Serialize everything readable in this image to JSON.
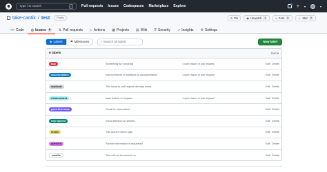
{
  "topbar": {
    "search_text": "Type / to search",
    "search_key": "/",
    "nav": [
      "Pull requests",
      "Issues",
      "Codespaces",
      "Marketplace",
      "Explore"
    ],
    "plus": "+",
    "caret": "▾"
  },
  "repo": {
    "owner": "take-cantik",
    "separator": "/",
    "name": "test",
    "visibility": "Public",
    "actions": [
      {
        "label": "Pin",
        "icon": "pin-icon",
        "count": ""
      },
      {
        "label": "Unwatch",
        "icon": "eye-icon",
        "count": "1"
      },
      {
        "label": "Fork",
        "icon": "fork-icon",
        "count": "0"
      },
      {
        "label": "Star",
        "icon": "star-icon",
        "count": "0"
      }
    ],
    "tabs": [
      {
        "label": "Code",
        "icon": "<>",
        "count": ""
      },
      {
        "label": "Issues",
        "icon": "◎",
        "count": "8"
      },
      {
        "label": "Pull requests",
        "icon": "⇅",
        "count": ""
      },
      {
        "label": "Actions",
        "icon": "▷",
        "count": ""
      },
      {
        "label": "Projects",
        "icon": "▦",
        "count": ""
      },
      {
        "label": "Wiki",
        "icon": "▤",
        "count": ""
      },
      {
        "label": "Security",
        "icon": "⛨",
        "count": ""
      },
      {
        "label": "Insights",
        "icon": "↗",
        "count": ""
      },
      {
        "label": "Settings",
        "icon": "⚙",
        "count": ""
      }
    ]
  },
  "toolbar": {
    "labels_tab": "Labels",
    "milestones_tab": "Milestones",
    "search_placeholder": "Search all labels",
    "new_label": "New label"
  },
  "labels_box": {
    "count_text": "9 labels",
    "sort": "Sort ▾",
    "edit": "Edit",
    "delete": "Delete",
    "rows": [
      {
        "name": "bug",
        "bg": "#d73a4a",
        "fg": "#ffffff",
        "description": "Something isn't working",
        "usage": "1 open issue or pull request"
      },
      {
        "name": "documentation",
        "bg": "#0075ca",
        "fg": "#ffffff",
        "description": "Improvements or additions to documentation",
        "usage": "1 open issue or pull request"
      },
      {
        "name": "duplicate",
        "bg": "#cfd3d7",
        "fg": "#24292f",
        "description": "This issue or pull request already exists",
        "usage": ""
      },
      {
        "name": "enhancement",
        "bg": "#a2eeef",
        "fg": "#24292f",
        "description": "New feature or request",
        "usage": "1 open issue or pull request"
      },
      {
        "name": "good first issue",
        "bg": "#7057ff",
        "fg": "#ffffff",
        "description": "Good for newcomers",
        "usage": ""
      },
      {
        "name": "help wanted",
        "bg": "#008672",
        "fg": "#ffffff",
        "description": "Extra attention is needed",
        "usage": ""
      },
      {
        "name": "invalid",
        "bg": "#e4e669",
        "fg": "#24292f",
        "description": "This doesn't seem right",
        "usage": ""
      },
      {
        "name": "question",
        "bg": "#d876e3",
        "fg": "#24292f",
        "description": "Further information is requested",
        "usage": ""
      },
      {
        "name": "wontfix",
        "bg": "#ffffff",
        "fg": "#24292f",
        "description": "This will not be worked on",
        "usage": ""
      }
    ]
  }
}
